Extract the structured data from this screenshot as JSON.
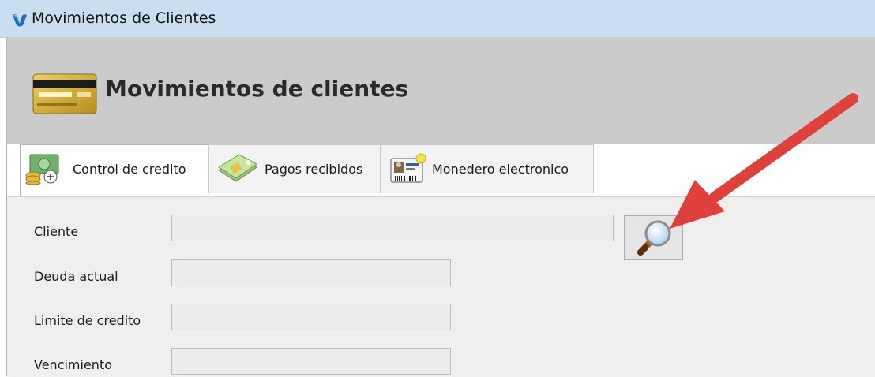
{
  "window": {
    "title": "Movimientos de Clientes",
    "icon": "app-logo-icon"
  },
  "header": {
    "title": "Movimientos de clientes",
    "icon": "credit-card-icon"
  },
  "tabs": [
    {
      "label": "Control de credito",
      "icon": "money-calculator-icon",
      "active": true
    },
    {
      "label": "Pagos recibidos",
      "icon": "cash-bundle-icon",
      "active": false
    },
    {
      "label": "Monedero electronico",
      "icon": "id-card-icon",
      "active": false
    }
  ],
  "form": {
    "cliente_label": "Cliente",
    "cliente_value": "",
    "deuda_label": "Deuda actual",
    "deuda_value": "",
    "limite_label": "Limite de credito",
    "limite_value": "",
    "vencimiento_label": "Vencimiento",
    "vencimiento_value": ""
  },
  "search_button": {
    "icon": "magnifier-icon"
  },
  "annotation": {
    "color": "#e0403a",
    "icon": "red-arrow"
  },
  "colors": {
    "titlebar": "#c9dff1",
    "header_band": "#cbcbcb",
    "content_bg": "#efefef"
  }
}
